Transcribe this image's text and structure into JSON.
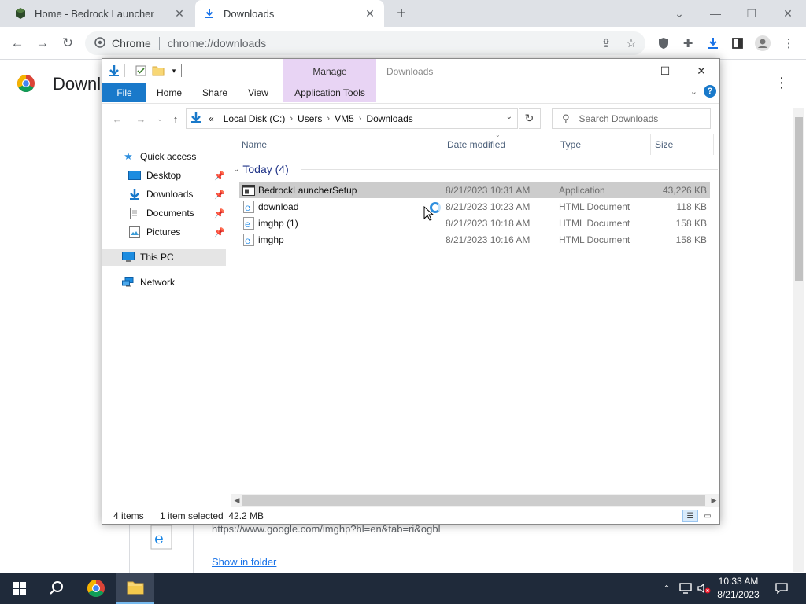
{
  "chrome": {
    "tabs": [
      {
        "label": "Home - Bedrock Launcher",
        "icon": "bedrock-icon",
        "active": false
      },
      {
        "label": "Downloads",
        "icon": "download-icon",
        "active": true
      }
    ],
    "new_tab_glyph": "+",
    "omnibox": {
      "site": "Chrome",
      "url": "chrome://downloads"
    }
  },
  "chrome_page": {
    "title": "Downl",
    "item_url": "https://www.google.com/imghp?hl=en&tab=ri&ogbl",
    "show_in_folder": "Show in folder"
  },
  "explorer": {
    "manage": "Manage",
    "window_title": "Downloads",
    "ribbon_tabs": [
      "File",
      "Home",
      "Share",
      "View",
      "Application Tools"
    ],
    "address": {
      "chevron": "«",
      "crumbs": [
        "Local Disk (C:)",
        "Users",
        "VM5",
        "Downloads"
      ]
    },
    "search_placeholder": "Search Downloads",
    "nav": {
      "quick_access": "Quick access",
      "desktop": "Desktop",
      "downloads": "Downloads",
      "documents": "Documents",
      "pictures": "Pictures",
      "this_pc": "This PC",
      "network": "Network"
    },
    "columns": {
      "name": "Name",
      "date": "Date modified",
      "type": "Type",
      "size": "Size"
    },
    "group": "Today (4)",
    "files": [
      {
        "name": "BedrockLauncherSetup",
        "date": "8/21/2023 10:31 AM",
        "type": "Application",
        "size": "43,226 KB",
        "selected": true
      },
      {
        "name": "download",
        "date": "8/21/2023 10:23 AM",
        "type": "HTML Document",
        "size": "118 KB"
      },
      {
        "name": "imghp (1)",
        "date": "8/21/2023 10:18 AM",
        "type": "HTML Document",
        "size": "158 KB"
      },
      {
        "name": "imghp",
        "date": "8/21/2023 10:16 AM",
        "type": "HTML Document",
        "size": "158 KB"
      }
    ],
    "status": {
      "count": "4 items",
      "selection": "1 item selected  42.2 MB"
    }
  },
  "taskbar": {
    "time": "10:33 AM",
    "date": "8/21/2023"
  },
  "colors": {
    "file_tab": "#1979ca",
    "manage_tab": "#e8d4f4",
    "group_header": "#1e3287",
    "taskbar": "#1f2a3a",
    "chrome_strip": "#dee1e6"
  }
}
